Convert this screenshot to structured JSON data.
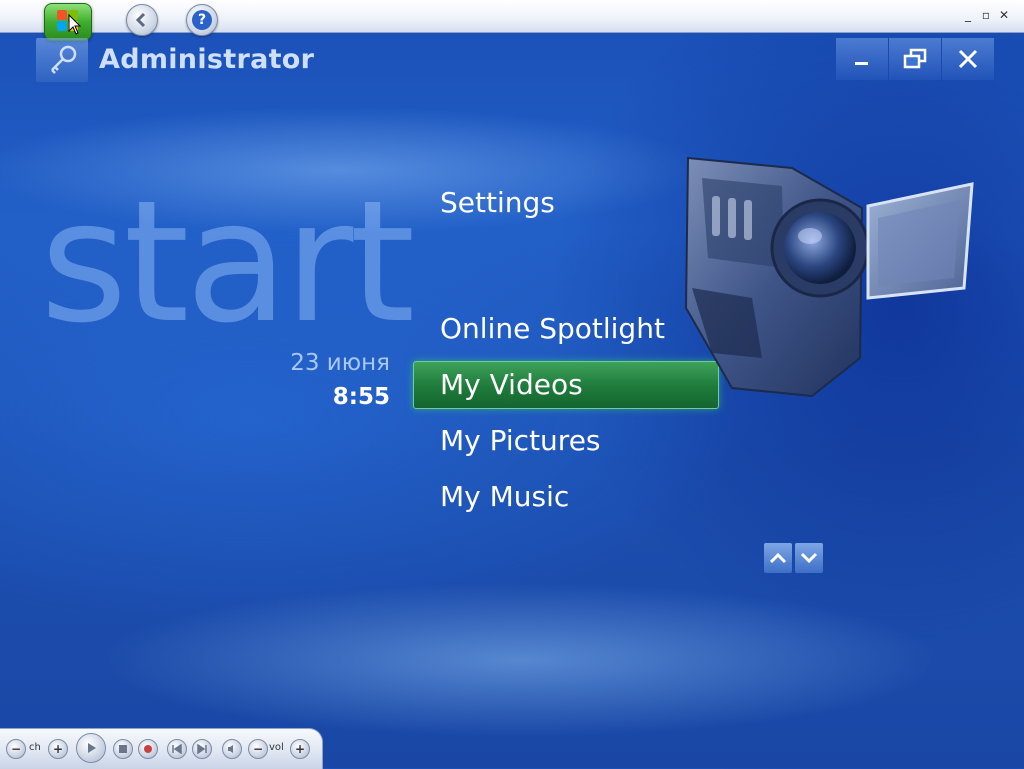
{
  "header": {
    "user_name": "Administrator",
    "user_icon": "key-icon"
  },
  "window_controls": [
    "minimize-icon",
    "restore-icon",
    "close-icon"
  ],
  "start": {
    "word": "start",
    "date": "23 июня",
    "time": "8:55"
  },
  "menu": {
    "items": [
      {
        "label": "Settings"
      },
      {
        "label": "Online Spotlight"
      },
      {
        "label": "My Videos",
        "focused": true
      },
      {
        "label": "My Pictures"
      },
      {
        "label": "My Music"
      }
    ]
  },
  "transport": {
    "ch_label": "ch",
    "vol_label": "vol"
  },
  "colors": {
    "focus": "#1e7a3a",
    "background": "#1f58c0",
    "user_name": "#cfe0ff"
  }
}
